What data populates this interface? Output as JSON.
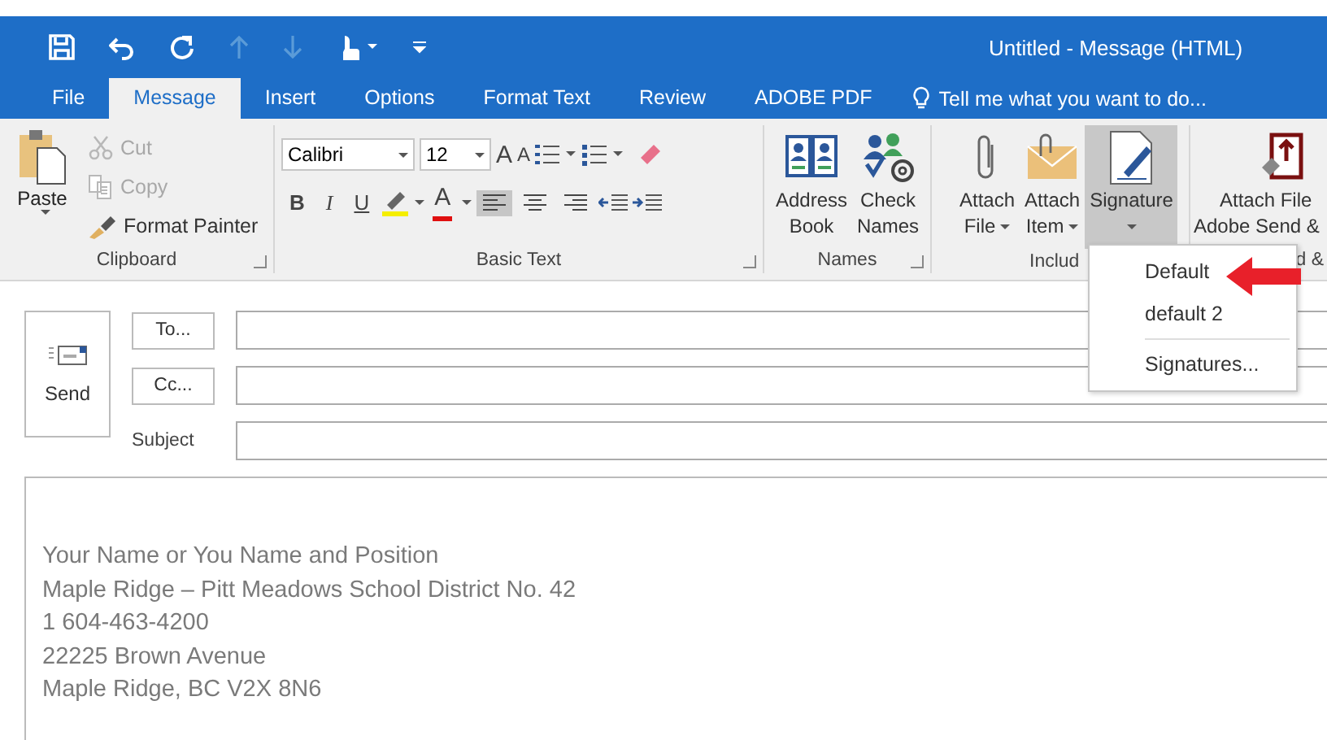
{
  "window": {
    "title": "Untitled - Message (HTML)"
  },
  "quick_access": [
    {
      "kind": "save",
      "disabled": false
    },
    {
      "kind": "undo",
      "disabled": false
    },
    {
      "kind": "redo",
      "disabled": false
    },
    {
      "kind": "up",
      "disabled": true
    },
    {
      "kind": "down",
      "disabled": true
    },
    {
      "kind": "touch",
      "disabled": false
    },
    {
      "kind": "customize",
      "disabled": false
    }
  ],
  "tabs": [
    {
      "label": "File",
      "selected": false
    },
    {
      "label": "Message",
      "selected": true
    },
    {
      "label": "Insert",
      "selected": false
    },
    {
      "label": "Options",
      "selected": false
    },
    {
      "label": "Format Text",
      "selected": false
    },
    {
      "label": "Review",
      "selected": false
    },
    {
      "label": "ADOBE PDF",
      "selected": false
    }
  ],
  "tell_me": "Tell me what you want to do...",
  "clipboard": {
    "label": "Clipboard",
    "paste": "Paste",
    "items": [
      {
        "label": "Cut",
        "kind": "cut",
        "disabled": true
      },
      {
        "label": "Copy",
        "kind": "copy",
        "disabled": true
      },
      {
        "label": "Format Painter",
        "kind": "painter",
        "disabled": false
      }
    ]
  },
  "basic_text": {
    "label": "Basic Text",
    "font": "Calibri",
    "size": "12",
    "grow": "A",
    "shrink": "A",
    "styles": [
      "B",
      "I",
      "U"
    ],
    "font_color": "A",
    "align": [
      {
        "kind": "left",
        "selected": true
      },
      {
        "kind": "center",
        "selected": false
      },
      {
        "kind": "right",
        "selected": false
      }
    ]
  },
  "names": {
    "label": "Names",
    "buttons": [
      {
        "kind": "address-book",
        "lines": [
          "Address",
          "Book"
        ]
      },
      {
        "kind": "check-names",
        "lines": [
          "Check",
          "Names"
        ]
      }
    ]
  },
  "include": {
    "label": "Includ",
    "buttons": [
      {
        "kind": "attach-file",
        "lines": [
          "Attach",
          "File"
        ],
        "menu": true,
        "selected": false
      },
      {
        "kind": "attach-item",
        "lines": [
          "Attach",
          "Item"
        ],
        "menu": true,
        "selected": false
      },
      {
        "kind": "signature",
        "lines": [
          "Signature"
        ],
        "menu": true,
        "selected": true
      }
    ]
  },
  "adobe": {
    "label": "d &",
    "lines": [
      "Attach File",
      "Adobe Send &"
    ]
  },
  "signature_menu": [
    {
      "label": "Default"
    },
    {
      "label": "default 2"
    },
    {
      "label": "Signatures..."
    }
  ],
  "compose": {
    "send": "Send",
    "to": "To...",
    "cc": "Cc...",
    "subject": "Subject"
  },
  "body": [
    "Your Name or You Name and Position",
    "Maple Ridge – Pitt Meadows School District No. 42",
    "1 604-463-4200",
    "22225 Brown Avenue",
    "Maple Ridge, BC V2X 8N6"
  ]
}
